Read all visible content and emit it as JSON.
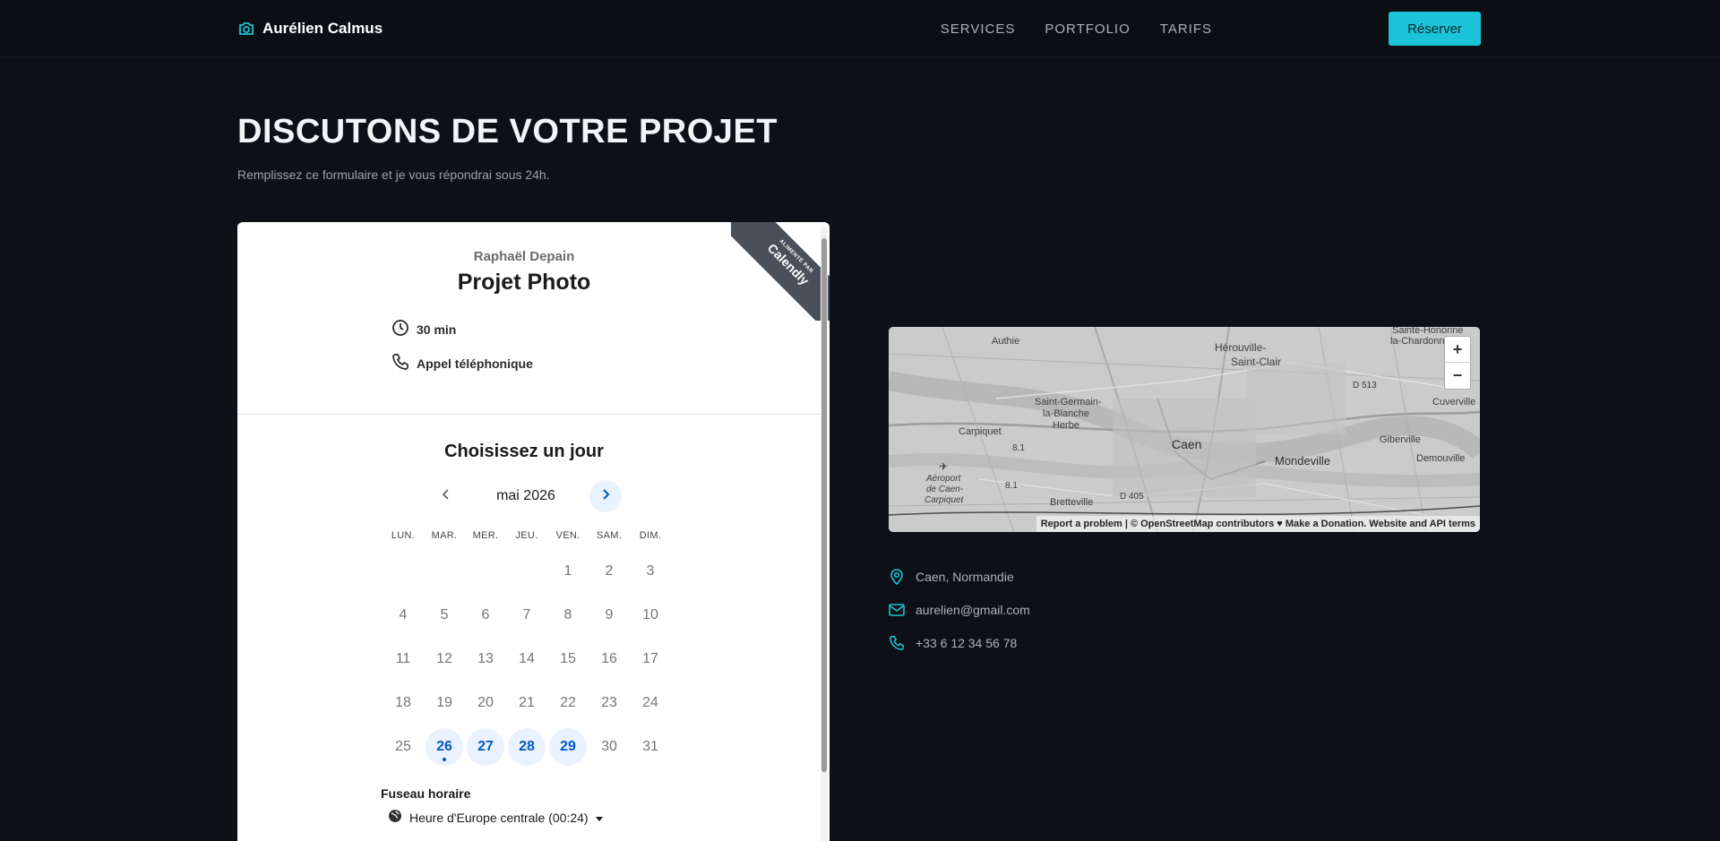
{
  "header": {
    "brand": "Aurélien Calmus",
    "nav": [
      "SERVICES",
      "PORTFOLIO",
      "TARIFS"
    ],
    "cta": "Réserver",
    "accent_color": "#1bc3d8"
  },
  "hero": {
    "title": "DISCUTONS DE VOTRE PROJET",
    "subtitle": "Remplissez ce formulaire et je vous répondrai sous 24h."
  },
  "calendly": {
    "ribbon_small": "ALIMENTÉ PAR",
    "ribbon_big": "Calendly",
    "organizer": "Raphaël Depain",
    "event_title": "Projet Photo",
    "duration": "30 min",
    "location": "Appel téléphonique",
    "choose_day": "Choisissez un jour",
    "month": "mai 2026",
    "weekdays": [
      "LUN.",
      "MAR.",
      "MER.",
      "JEU.",
      "VEN.",
      "SAM.",
      "DIM."
    ],
    "weeks": [
      [
        "",
        "",
        "",
        "",
        "1",
        "2",
        "3"
      ],
      [
        "4",
        "5",
        "6",
        "7",
        "8",
        "9",
        "10"
      ],
      [
        "11",
        "12",
        "13",
        "14",
        "15",
        "16",
        "17"
      ],
      [
        "18",
        "19",
        "20",
        "21",
        "22",
        "23",
        "24"
      ],
      [
        "25",
        "26",
        "27",
        "28",
        "29",
        "30",
        "31"
      ]
    ],
    "available_days": [
      "26",
      "27",
      "28",
      "29"
    ],
    "today": "26",
    "timezone_label": "Fuseau horaire",
    "timezone_value": "Heure d'Europe centrale (00:24)"
  },
  "map": {
    "labels": {
      "herouville": "Hérouville-",
      "saint_clair": "Saint-Clair",
      "authie": "Authie",
      "saint_germain": "Saint-Germain-",
      "la_blanche": "la-Blanche",
      "herbe": "Herbe",
      "carpiquet": "Carpiquet",
      "caen": "Caen",
      "mondeville": "Mondeville",
      "giberville": "Giberville",
      "demouville": "Demouville",
      "cuverville": "Cuverville",
      "sainte_honorine": "Sainte-Honorine",
      "la_chardonne": "la-Chardonne",
      "aeroport1": "Aéroport",
      "aeroport2": "de Caen-",
      "aeroport3": "Carpiquet",
      "bretteville": "Bretteville",
      "d513": "D 513",
      "d405": "D 405",
      "r81": "8.1",
      "r81b": "8.1"
    },
    "zoom_in": "+",
    "zoom_out": "−",
    "attribution": "Report a problem | © OpenStreetMap contributors ♥ Make a Donation. Website and API terms"
  },
  "contact": {
    "location": "Caen, Normandie",
    "email": "aurelien@gmail.com",
    "phone": "+33 6 12 34 56 78"
  }
}
